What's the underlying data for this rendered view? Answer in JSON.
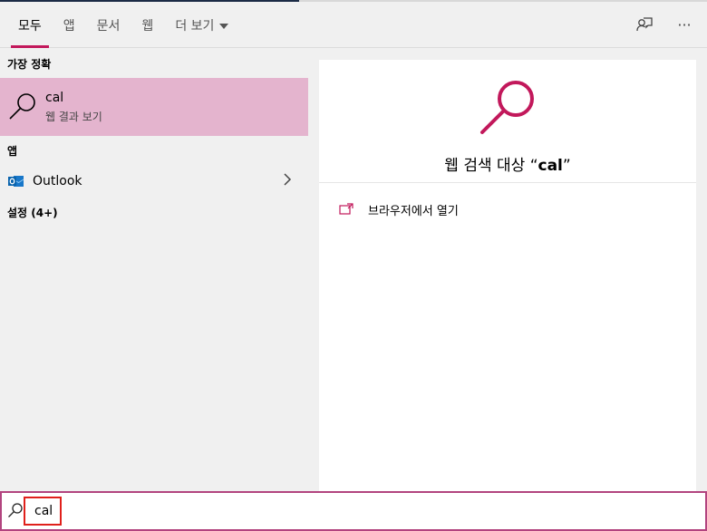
{
  "tabs": [
    {
      "label": "모두",
      "active": true
    },
    {
      "label": "앱"
    },
    {
      "label": "문서"
    },
    {
      "label": "웹"
    },
    {
      "label": "더 보기"
    }
  ],
  "header_icons": [
    "feedback-icon",
    "more-options-icon"
  ],
  "header_more_glyph": "···",
  "left": {
    "best_match_title": "가장 정확",
    "best_match": {
      "title": "cal",
      "subtitle": "웹 결과 보기",
      "icon": "search-icon"
    },
    "apps_title": "앱",
    "apps": [
      {
        "label": "Outlook",
        "icon": "outlook-icon"
      }
    ],
    "settings_title": "설정 (4+)"
  },
  "right": {
    "preview_prefix": "웹 검색 대상 “",
    "preview_query": "cal",
    "preview_suffix": "”",
    "action_label": "브라우저에서 열기"
  },
  "search": {
    "value": "cal"
  },
  "colors": {
    "accent": "#c2185b",
    "selection": "#e4b4ce",
    "highlight_box": "#e0201b"
  }
}
